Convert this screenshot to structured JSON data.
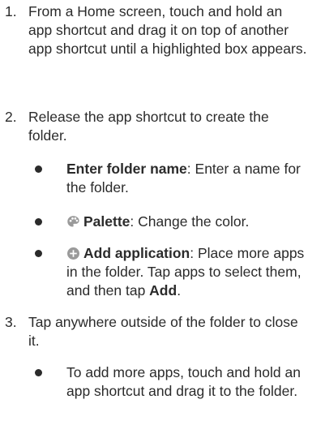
{
  "steps": [
    {
      "number": "1.",
      "text": "From a Home screen, touch and hold an app shortcut and drag it on top of another app shortcut until a highlighted box appears."
    },
    {
      "number": "2.",
      "text": "Release the app shortcut to create the folder.",
      "bullets": [
        {
          "term": "Enter folder name",
          "sep": ": ",
          "desc": "Enter a name for the folder."
        },
        {
          "icon": "palette-icon",
          "term": "Palette",
          "sep": ": ",
          "desc": "Change the color."
        },
        {
          "icon": "add-circle-icon",
          "term": "Add application",
          "sep": ": ",
          "desc": "Place more apps in the folder. Tap apps to select them, and then tap ",
          "emph": "Add",
          "end": "."
        }
      ]
    },
    {
      "number": "3.",
      "text": "Tap anywhere outside of the folder to close it.",
      "bullets": [
        {
          "desc": "To add more apps, touch and hold an app shortcut and drag it to the folder."
        }
      ]
    }
  ],
  "colors": {
    "text": "#2b2b2b",
    "icon": "#9a9a9a"
  }
}
